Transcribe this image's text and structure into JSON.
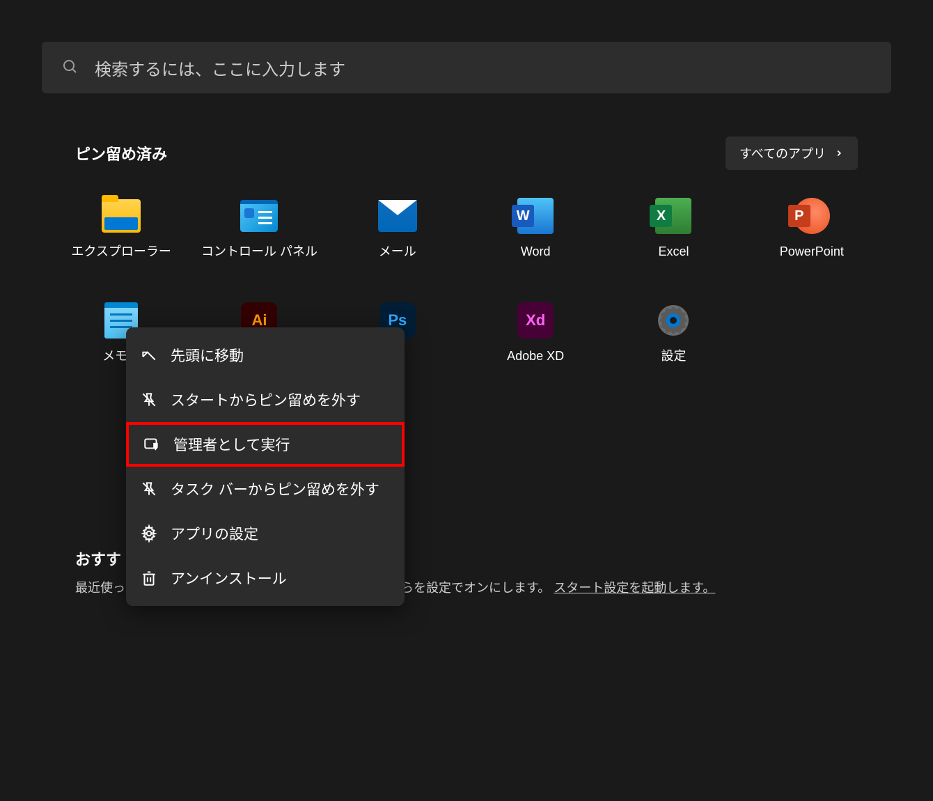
{
  "search": {
    "placeholder": "検索するには、ここに入力します"
  },
  "pinned": {
    "title": "ピン留め済み",
    "all_apps_label": "すべてのアプリ",
    "items": [
      {
        "label": "エクスプローラー",
        "icon": "folder"
      },
      {
        "label": "コントロール パネル",
        "icon": "control-panel"
      },
      {
        "label": "メール",
        "icon": "mail"
      },
      {
        "label": "Word",
        "icon": "word"
      },
      {
        "label": "Excel",
        "icon": "excel"
      },
      {
        "label": "PowerPoint",
        "icon": "powerpoint"
      },
      {
        "label": "メモ帳",
        "icon": "notepad"
      },
      {
        "label": "Ai",
        "icon": "illustrator"
      },
      {
        "label": "Ps",
        "icon": "photoshop"
      },
      {
        "label": "Adobe XD",
        "icon": "xd"
      },
      {
        "label": "設定",
        "icon": "settings"
      }
    ]
  },
  "recommended": {
    "title": "おすす",
    "text_prefix": "最近使ったファイルと新しいアプリを表示するには、これらを設定でオンにします。 ",
    "link_text": "スタート設定を起動します。"
  },
  "context_menu": {
    "items": [
      {
        "label": "先頭に移動",
        "icon": "move-to-front"
      },
      {
        "label": "スタートからピン留めを外す",
        "icon": "unpin"
      },
      {
        "label": "管理者として実行",
        "icon": "run-as-admin",
        "highlighted": true
      },
      {
        "label": "タスク バーからピン留めを外す",
        "icon": "unpin-taskbar"
      },
      {
        "label": "アプリの設定",
        "icon": "app-settings"
      },
      {
        "label": "アンインストール",
        "icon": "uninstall"
      }
    ]
  }
}
